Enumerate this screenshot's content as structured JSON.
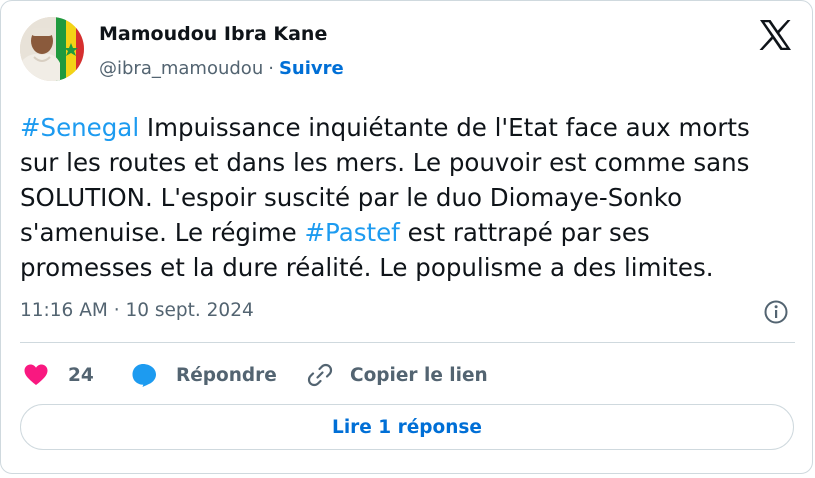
{
  "author": {
    "name": "Mamoudou Ibra Kane",
    "handle": "@ibra_mamoudou",
    "separator": "·",
    "follow_label": "Suivre"
  },
  "tweet": {
    "lines": [
      [
        {
          "text": "#Senegal",
          "hashtag": true
        },
        {
          "text": " Impuissance inquiétante de l'Etat face aux morts",
          "hashtag": false
        }
      ],
      [
        {
          "text": "sur les routes et dans les mers. Le pouvoir est comme sans",
          "hashtag": false
        }
      ],
      [
        {
          "text": "SOLUTION. L'espoir suscité par le duo Diomaye-Sonko",
          "hashtag": false
        }
      ],
      [
        {
          "text": "s'amenuise. Le régime ",
          "hashtag": false
        },
        {
          "text": "#Pastef",
          "hashtag": true
        },
        {
          "text": " est rattrapé par ses",
          "hashtag": false
        }
      ],
      [
        {
          "text": "promesses et la dure réalité. Le populisme a des limites.",
          "hashtag": false
        }
      ]
    ],
    "timestamp": "11:16 AM · 10 sept. 2024"
  },
  "actions": {
    "like_count": "24",
    "reply_label": "Répondre",
    "copy_link_label": "Copier le lien"
  },
  "read_replies_label": "Lire 1 réponse",
  "colors": {
    "like": "#f91880",
    "reply": "#1d9bf0",
    "hashtag": "#1d9bf0",
    "link": "#006fd6",
    "muted": "#536471",
    "border": "#cfd9de"
  }
}
